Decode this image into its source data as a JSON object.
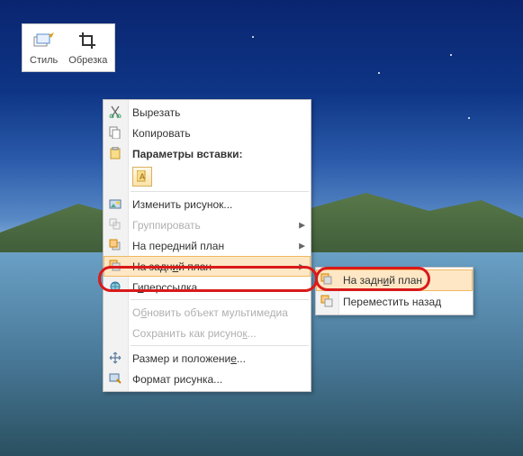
{
  "ribbon": {
    "style_label": "Стиль",
    "crop_label": "Обрезка"
  },
  "context_menu": {
    "cut": "Вырезать",
    "copy": "Копировать",
    "paste_header": "Параметры вставки:",
    "paste_opt_a": "A",
    "change_picture": "Изменить рисунок...",
    "group": "Группировать",
    "bring_front": "На передний план",
    "send_back_prefix": "На задн",
    "send_back_u": "и",
    "send_back_suffix": "й план",
    "hyperlink_prefix": "Г",
    "hyperlink_u": "и",
    "hyperlink_suffix": "перссылка...",
    "update_media_prefix": "О",
    "update_media_u": "б",
    "update_media_suffix": "новить объект мультимедиа",
    "save_as_picture_prefix": "Сохранить как рисуно",
    "save_as_picture_u": "к",
    "save_as_picture_suffix": "...",
    "size_position_prefix": "Размер и положени",
    "size_position_u": "е",
    "size_position_suffix": "...",
    "format_picture": "Формат рисунка..."
  },
  "submenu": {
    "send_back_prefix": "На задн",
    "send_back_u": "и",
    "send_back_suffix": "й план",
    "move_back_prefix": "Переместить наза",
    "move_back_u": "д"
  }
}
